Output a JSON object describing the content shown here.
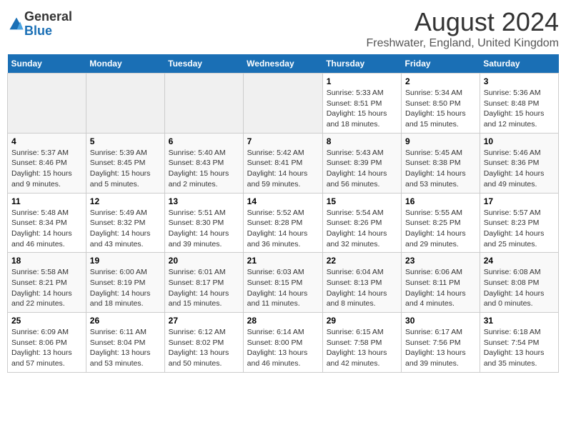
{
  "logo": {
    "general": "General",
    "blue": "Blue"
  },
  "title": {
    "month_year": "August 2024",
    "location": "Freshwater, England, United Kingdom"
  },
  "weekdays": [
    "Sunday",
    "Monday",
    "Tuesday",
    "Wednesday",
    "Thursday",
    "Friday",
    "Saturday"
  ],
  "weeks": [
    [
      {
        "day": "",
        "info": ""
      },
      {
        "day": "",
        "info": ""
      },
      {
        "day": "",
        "info": ""
      },
      {
        "day": "",
        "info": ""
      },
      {
        "day": "1",
        "info": "Sunrise: 5:33 AM\nSunset: 8:51 PM\nDaylight: 15 hours\nand 18 minutes."
      },
      {
        "day": "2",
        "info": "Sunrise: 5:34 AM\nSunset: 8:50 PM\nDaylight: 15 hours\nand 15 minutes."
      },
      {
        "day": "3",
        "info": "Sunrise: 5:36 AM\nSunset: 8:48 PM\nDaylight: 15 hours\nand 12 minutes."
      }
    ],
    [
      {
        "day": "4",
        "info": "Sunrise: 5:37 AM\nSunset: 8:46 PM\nDaylight: 15 hours\nand 9 minutes."
      },
      {
        "day": "5",
        "info": "Sunrise: 5:39 AM\nSunset: 8:45 PM\nDaylight: 15 hours\nand 5 minutes."
      },
      {
        "day": "6",
        "info": "Sunrise: 5:40 AM\nSunset: 8:43 PM\nDaylight: 15 hours\nand 2 minutes."
      },
      {
        "day": "7",
        "info": "Sunrise: 5:42 AM\nSunset: 8:41 PM\nDaylight: 14 hours\nand 59 minutes."
      },
      {
        "day": "8",
        "info": "Sunrise: 5:43 AM\nSunset: 8:39 PM\nDaylight: 14 hours\nand 56 minutes."
      },
      {
        "day": "9",
        "info": "Sunrise: 5:45 AM\nSunset: 8:38 PM\nDaylight: 14 hours\nand 53 minutes."
      },
      {
        "day": "10",
        "info": "Sunrise: 5:46 AM\nSunset: 8:36 PM\nDaylight: 14 hours\nand 49 minutes."
      }
    ],
    [
      {
        "day": "11",
        "info": "Sunrise: 5:48 AM\nSunset: 8:34 PM\nDaylight: 14 hours\nand 46 minutes."
      },
      {
        "day": "12",
        "info": "Sunrise: 5:49 AM\nSunset: 8:32 PM\nDaylight: 14 hours\nand 43 minutes."
      },
      {
        "day": "13",
        "info": "Sunrise: 5:51 AM\nSunset: 8:30 PM\nDaylight: 14 hours\nand 39 minutes."
      },
      {
        "day": "14",
        "info": "Sunrise: 5:52 AM\nSunset: 8:28 PM\nDaylight: 14 hours\nand 36 minutes."
      },
      {
        "day": "15",
        "info": "Sunrise: 5:54 AM\nSunset: 8:26 PM\nDaylight: 14 hours\nand 32 minutes."
      },
      {
        "day": "16",
        "info": "Sunrise: 5:55 AM\nSunset: 8:25 PM\nDaylight: 14 hours\nand 29 minutes."
      },
      {
        "day": "17",
        "info": "Sunrise: 5:57 AM\nSunset: 8:23 PM\nDaylight: 14 hours\nand 25 minutes."
      }
    ],
    [
      {
        "day": "18",
        "info": "Sunrise: 5:58 AM\nSunset: 8:21 PM\nDaylight: 14 hours\nand 22 minutes."
      },
      {
        "day": "19",
        "info": "Sunrise: 6:00 AM\nSunset: 8:19 PM\nDaylight: 14 hours\nand 18 minutes."
      },
      {
        "day": "20",
        "info": "Sunrise: 6:01 AM\nSunset: 8:17 PM\nDaylight: 14 hours\nand 15 minutes."
      },
      {
        "day": "21",
        "info": "Sunrise: 6:03 AM\nSunset: 8:15 PM\nDaylight: 14 hours\nand 11 minutes."
      },
      {
        "day": "22",
        "info": "Sunrise: 6:04 AM\nSunset: 8:13 PM\nDaylight: 14 hours\nand 8 minutes."
      },
      {
        "day": "23",
        "info": "Sunrise: 6:06 AM\nSunset: 8:11 PM\nDaylight: 14 hours\nand 4 minutes."
      },
      {
        "day": "24",
        "info": "Sunrise: 6:08 AM\nSunset: 8:08 PM\nDaylight: 14 hours\nand 0 minutes."
      }
    ],
    [
      {
        "day": "25",
        "info": "Sunrise: 6:09 AM\nSunset: 8:06 PM\nDaylight: 13 hours\nand 57 minutes."
      },
      {
        "day": "26",
        "info": "Sunrise: 6:11 AM\nSunset: 8:04 PM\nDaylight: 13 hours\nand 53 minutes."
      },
      {
        "day": "27",
        "info": "Sunrise: 6:12 AM\nSunset: 8:02 PM\nDaylight: 13 hours\nand 50 minutes."
      },
      {
        "day": "28",
        "info": "Sunrise: 6:14 AM\nSunset: 8:00 PM\nDaylight: 13 hours\nand 46 minutes."
      },
      {
        "day": "29",
        "info": "Sunrise: 6:15 AM\nSunset: 7:58 PM\nDaylight: 13 hours\nand 42 minutes."
      },
      {
        "day": "30",
        "info": "Sunrise: 6:17 AM\nSunset: 7:56 PM\nDaylight: 13 hours\nand 39 minutes."
      },
      {
        "day": "31",
        "info": "Sunrise: 6:18 AM\nSunset: 7:54 PM\nDaylight: 13 hours\nand 35 minutes."
      }
    ]
  ]
}
